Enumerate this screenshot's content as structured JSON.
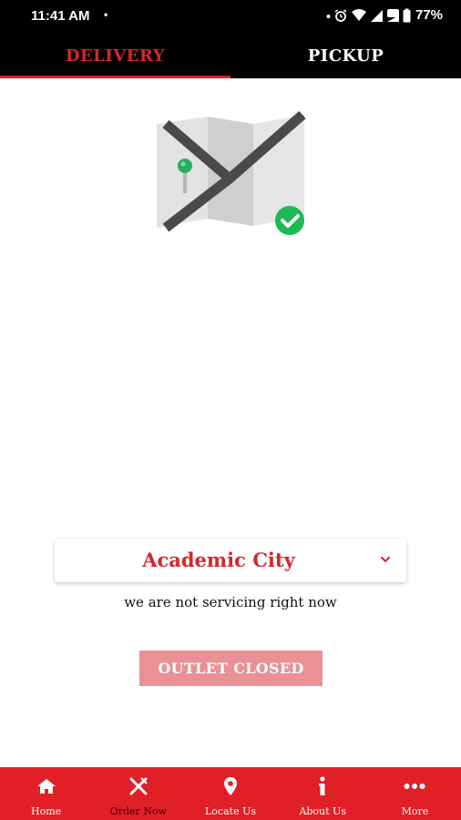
{
  "status_bar": {
    "time": "11:41 AM",
    "dot": "•",
    "battery": "77%"
  },
  "tabs": [
    {
      "label": "DELIVERY",
      "active": true
    },
    {
      "label": "PICKUP",
      "active": false
    }
  ],
  "outlet": {
    "selected": "Academic City"
  },
  "service_status": "we are not servicing right now",
  "outlet_button": "OUTLET CLOSED",
  "bottom_nav": [
    {
      "label": "Home",
      "icon": "home-icon"
    },
    {
      "label": "Order Now",
      "icon": "utensils-icon"
    },
    {
      "label": "Locate Us",
      "icon": "location-pin-icon"
    },
    {
      "label": "About Us",
      "icon": "info-icon"
    },
    {
      "label": "More",
      "icon": "more-dots-icon"
    }
  ],
  "colors": {
    "brand_red": "#e11f26",
    "tab_active": "#d6262b",
    "button_disabled": "#e99195",
    "check_green": "#1db954"
  }
}
